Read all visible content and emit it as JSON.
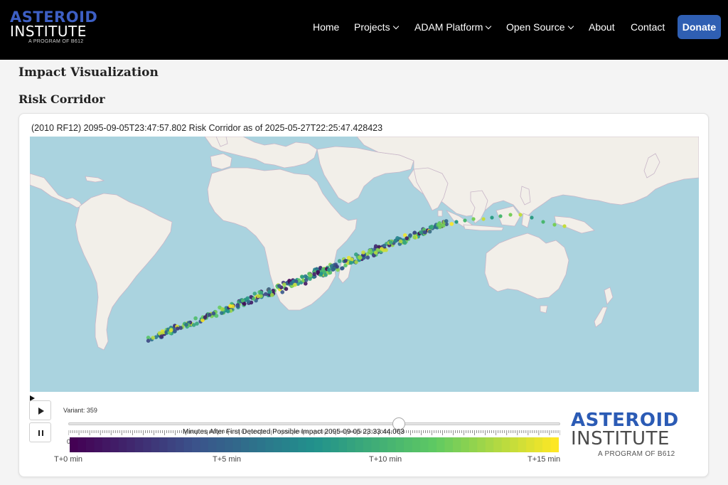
{
  "header": {
    "logo": {
      "line1": "ASTEROID",
      "line2": "INSTITUTE",
      "tagline": "A PROGRAM OF B612"
    },
    "nav": [
      {
        "label": "Home",
        "has_dropdown": false
      },
      {
        "label": "Projects",
        "has_dropdown": true
      },
      {
        "label": "ADAM Platform",
        "has_dropdown": true
      },
      {
        "label": "Open Source",
        "has_dropdown": true
      },
      {
        "label": "About",
        "has_dropdown": false
      },
      {
        "label": "Contact",
        "has_dropdown": false
      }
    ],
    "donate_label": "Donate"
  },
  "page": {
    "title": "Impact Visualization",
    "section_title": "Risk Corridor"
  },
  "plot": {
    "title": "(2010 RF12) 2095-09-05T23:47:57.802 Risk Corridor as of 2025-05-27T22:25:47.428423",
    "variant_label": "Variant: 359",
    "slider_label": "Minutes After First Detected Possible Impact 2095-09-05 23:33:44.063",
    "slider_zero": "0",
    "slider_value_fraction": 0.67,
    "colorbar_ticks": [
      "T+0 min",
      "T+5 min",
      "T+10 min",
      "T+15 min"
    ],
    "colorscale": [
      "#440154",
      "#3b528b",
      "#21918c",
      "#5ec962",
      "#fde725"
    ],
    "colors": {
      "ocean": "#aad3df",
      "land": "#f2efe9",
      "border": "#c8b6c8"
    }
  },
  "footer_logo": {
    "line1": "ASTEROID",
    "line2": "INSTITUTE",
    "tagline": "A PROGRAM OF B612"
  }
}
